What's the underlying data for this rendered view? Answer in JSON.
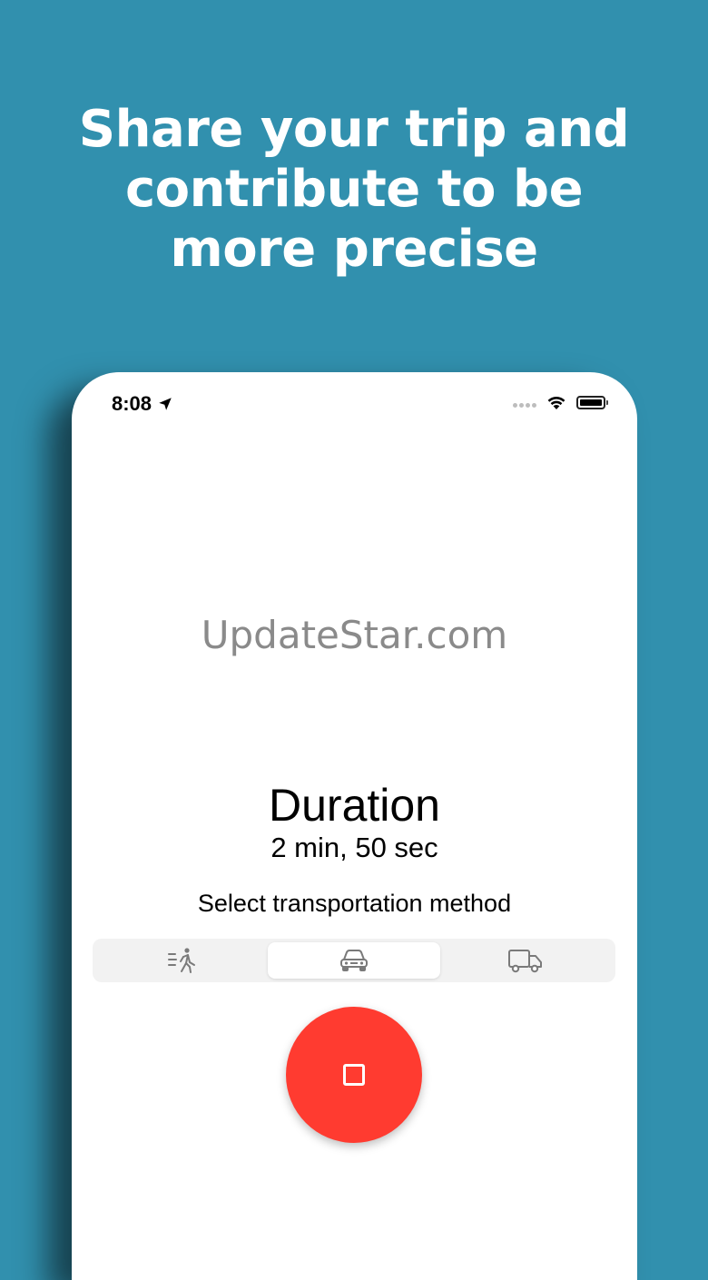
{
  "headline": {
    "line1": "Share your trip and",
    "line2": "contribute to be",
    "line3": "more precise"
  },
  "status_bar": {
    "time": "8:08",
    "location_icon": "location-arrow-icon",
    "wifi_icon": "wifi-icon",
    "battery_icon": "battery-icon"
  },
  "watermark": "UpdateStar.com",
  "trip": {
    "duration_title": "Duration",
    "duration_value": "2 min, 50 sec",
    "select_label": "Select transportation method"
  },
  "transport_methods": [
    {
      "icon": "walking-icon",
      "selected": false
    },
    {
      "icon": "car-icon",
      "selected": true
    },
    {
      "icon": "truck-icon",
      "selected": false
    }
  ],
  "record_button": {
    "icon": "stop-icon",
    "color": "#ff3b30"
  },
  "colors": {
    "background": "#3190ae",
    "accent_red": "#ff3b30",
    "icon_gray": "#7a7a7a"
  }
}
